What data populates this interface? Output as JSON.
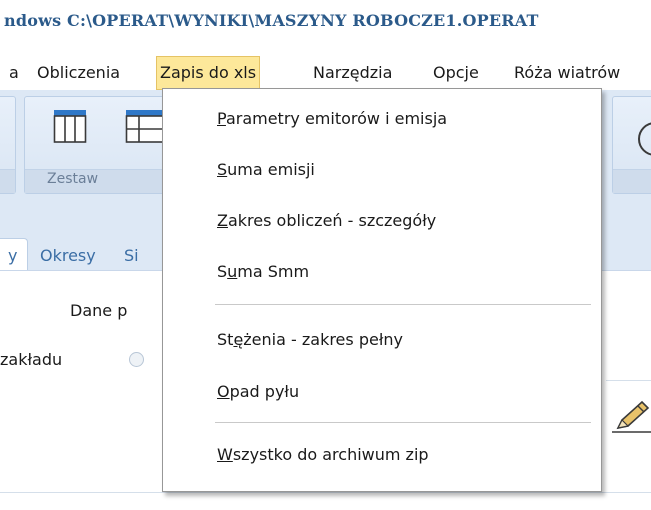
{
  "window": {
    "title": "ndows C:\\OPERAT\\WYNIKI\\MASZYNY ROBOCZE1.OPERAT"
  },
  "menubar": {
    "items": [
      {
        "label": "a"
      },
      {
        "label": "Obliczenia"
      },
      {
        "label": "Zapis do xls"
      },
      {
        "label": "Narzędzia"
      },
      {
        "label": "Opcje"
      },
      {
        "label": "Róża wiatrów"
      }
    ],
    "active_index": 2
  },
  "ribbon": {
    "group_label": "Zestaw"
  },
  "tabs": {
    "items": [
      {
        "label": "y"
      },
      {
        "label": "Okresy"
      },
      {
        "label": "Si"
      }
    ]
  },
  "panel": {
    "subheader": "Dane p",
    "radio_label": "zakładu"
  },
  "dropdown": {
    "items": [
      {
        "pre": "",
        "key": "P",
        "post": "arametry emitorów i emisja"
      },
      {
        "pre": "",
        "key": "S",
        "post": "uma emisji"
      },
      {
        "pre": "",
        "key": "Z",
        "post": "akres obliczeń - szczegóły"
      },
      {
        "pre": "S",
        "key": "u",
        "post": "ma Smm"
      },
      {
        "pre": "St",
        "key": "ę",
        "post": "żenia - zakres  pełny"
      },
      {
        "pre": "",
        "key": "O",
        "post": "pad pyłu"
      },
      {
        "pre": "",
        "key": "W",
        "post": "szystko do archiwum zip"
      }
    ]
  },
  "colors": {
    "menu_active_bg": "#fde89a",
    "ribbon_bg": "#dde8f5",
    "title_color": "#2b5a8a",
    "tab_text": "#3b6ea5"
  },
  "icons": [
    "table-columns-icon",
    "table-grid-icon",
    "circle-icon",
    "pencil-icon"
  ]
}
